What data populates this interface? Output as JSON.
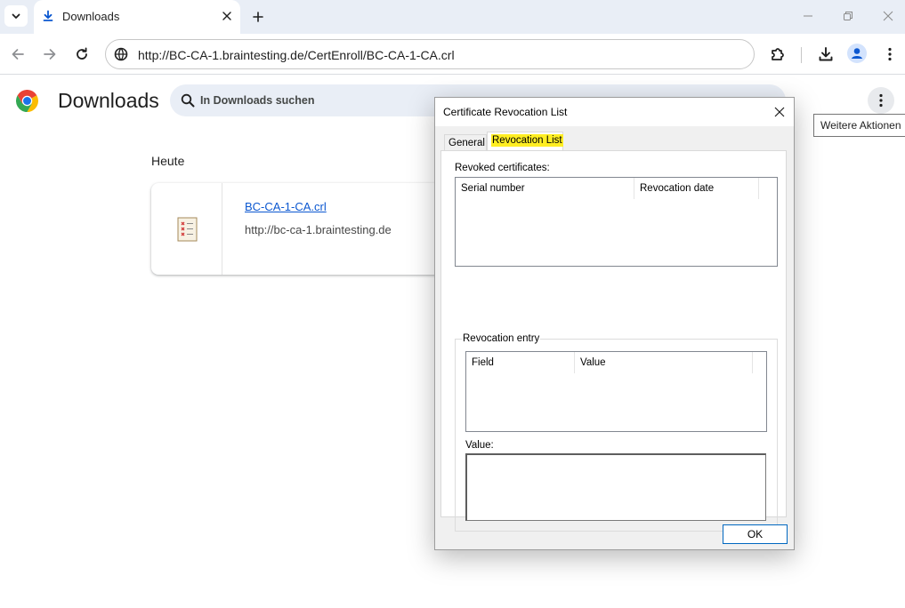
{
  "browser": {
    "tab": {
      "title": "Downloads"
    },
    "url": "http://BC-CA-1.braintesting.de/CertEnroll/BC-CA-1-CA.crl"
  },
  "downloads": {
    "title": "Downloads",
    "search_placeholder": "In Downloads suchen",
    "more_tooltip": "Weitere Aktionen",
    "section_label": "Heute",
    "items": [
      {
        "name": "BC-CA-1-CA.crl",
        "url": "http://bc-ca-1.braintesting.de"
      }
    ]
  },
  "dialog": {
    "title": "Certificate Revocation List",
    "tabs": [
      "General",
      "Revocation List"
    ],
    "active_tab": "Revocation List",
    "revoked_label": "Revoked certificates:",
    "revoked_columns": [
      "Serial number",
      "Revocation date"
    ],
    "entry_group_label": "Revocation entry",
    "entry_columns": [
      "Field",
      "Value"
    ],
    "value_label": "Value:",
    "ok_label": "OK"
  },
  "colors": {
    "tabstrip_bg": "#e9eef6",
    "link": "#0b57d0",
    "highlight": "#ffee22",
    "dialog_bg": "#f0f0f0",
    "ok_border": "#0067c0"
  },
  "icons": [
    "chevron-down-icon",
    "download-icon",
    "close-icon",
    "plus-icon",
    "minimize-icon",
    "restore-icon",
    "back-icon",
    "forward-icon",
    "reload-icon",
    "site-info-icon",
    "extensions-icon",
    "download-icon",
    "profile-icon",
    "more-vert-icon",
    "chrome-logo",
    "search-icon",
    "file-icon"
  ]
}
